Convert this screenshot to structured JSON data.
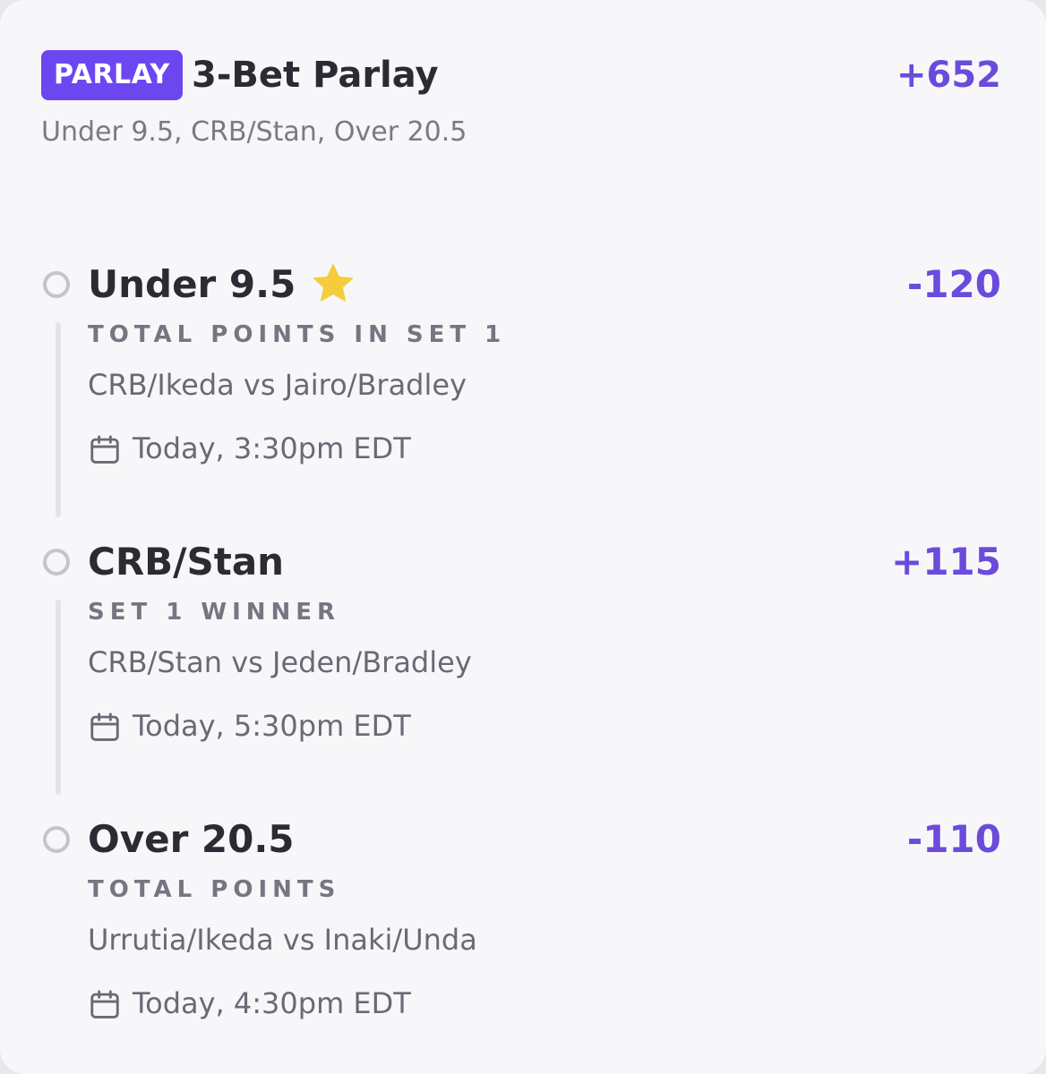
{
  "parlay": {
    "badge": "PARLAY",
    "title": "3-Bet Parlay",
    "odds": "+652",
    "summary": "Under 9.5, CRB/Stan, Over 20.5"
  },
  "legs": [
    {
      "selection": "Under 9.5",
      "starred": true,
      "odds": "-120",
      "market": "TOTAL POINTS IN SET 1",
      "matchup": "CRB/Ikeda vs Jairo/Bradley",
      "time": "Today, 3:30pm EDT"
    },
    {
      "selection": "CRB/Stan",
      "starred": false,
      "odds": "+115",
      "market": "SET 1 WINNER",
      "matchup": "CRB/Stan vs Jeden/Bradley",
      "time": "Today, 5:30pm EDT"
    },
    {
      "selection": "Over 20.5",
      "starred": false,
      "odds": "-110",
      "market": "TOTAL POINTS",
      "matchup": "Urrutia/Ikeda vs Inaki/Unda",
      "time": "Today, 4:30pm EDT"
    }
  ],
  "icons": {
    "leg_status": "empty-circle-icon",
    "favorite": "star-icon",
    "date": "calendar-icon"
  },
  "colors": {
    "accent": "#6c47f0",
    "odds": "#6a4bdc",
    "star": "#f5cc3c",
    "title_text": "#2b2b33",
    "muted_text": "#7a7a86"
  }
}
